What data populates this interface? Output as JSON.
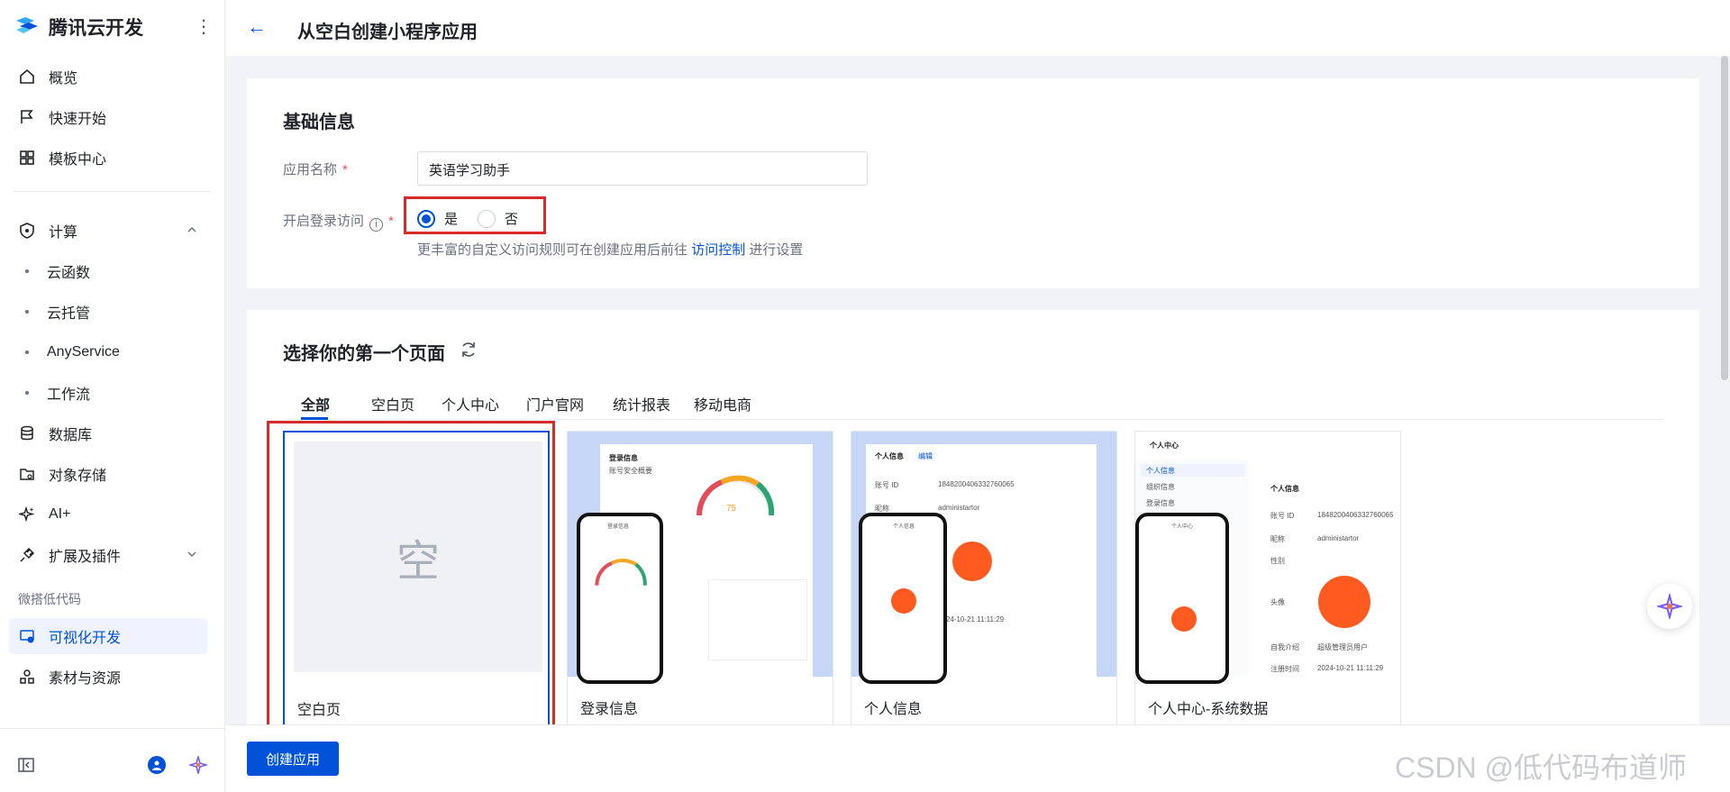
{
  "sidebar": {
    "brand": "腾讯云开发",
    "more": "⋮",
    "items": [
      {
        "label": "概览",
        "icon": "home-icon"
      },
      {
        "label": "快速开始",
        "icon": "flag-icon"
      },
      {
        "label": "模板中心",
        "icon": "grid-icon"
      }
    ],
    "compute": {
      "label": "计算",
      "icon": "shield-icon",
      "children": [
        "云函数",
        "云托管",
        "AnyService",
        "工作流"
      ]
    },
    "items2": [
      {
        "label": "数据库",
        "icon": "database-icon"
      },
      {
        "label": "对象存储",
        "icon": "folder-cloud-icon"
      },
      {
        "label": "AI+",
        "icon": "sparkle-icon"
      },
      {
        "label": "扩展及插件",
        "icon": "plug-icon"
      }
    ],
    "group_label": "微搭低代码",
    "lowcode": [
      {
        "label": "可视化开发",
        "icon": "visual-dev-icon",
        "active": true
      },
      {
        "label": "素材与资源",
        "icon": "assets-icon"
      }
    ]
  },
  "header": {
    "back": "←",
    "title": "从空白创建小程序应用"
  },
  "basic": {
    "title": "基础信息",
    "app_name_label": "应用名称",
    "required_mark": "*",
    "app_name_value": "英语学习助手",
    "login_label": "开启登录访问",
    "info_icon": "i",
    "yes": "是",
    "no": "否",
    "hint_prefix": "更丰富的自定义访问规则可在创建应用后前往",
    "hint_link": "访问控制",
    "hint_suffix": "进行设置"
  },
  "pages": {
    "title": "选择你的第一个页面",
    "tabs": [
      "全部",
      "空白页",
      "个人中心",
      "门户官网",
      "统计报表",
      "移动电商"
    ],
    "templates": [
      {
        "name": "空白页",
        "thumb_char": "空"
      },
      {
        "name": "登录信息"
      },
      {
        "name": "个人信息"
      },
      {
        "name": "个人中心-系统数据"
      }
    ],
    "mock": {
      "login_title": "登录信息",
      "login_sub": "账号安全概要",
      "gauge_value": "75",
      "personal_title": "个人信息",
      "edit": "编辑",
      "account_id_label": "账号 ID",
      "account_id": "1848200406332760065",
      "nick_label": "昵称",
      "nick": "administartor",
      "gender_label": "性别",
      "avatar_label": "头像",
      "intro_label": "自我介绍",
      "intro": "超级管理员用户",
      "reg_label": "注册时间",
      "reg": "2024-10-21 11:11:29",
      "center_title": "个人中心",
      "center_menu": [
        "个人信息",
        "组织信息",
        "登录信息"
      ]
    }
  },
  "footer": {
    "create": "创建应用"
  },
  "watermark": "CSDN @低代码布道师",
  "colors": {
    "primary": "#0052d9",
    "highlight": "#d62b2b"
  }
}
